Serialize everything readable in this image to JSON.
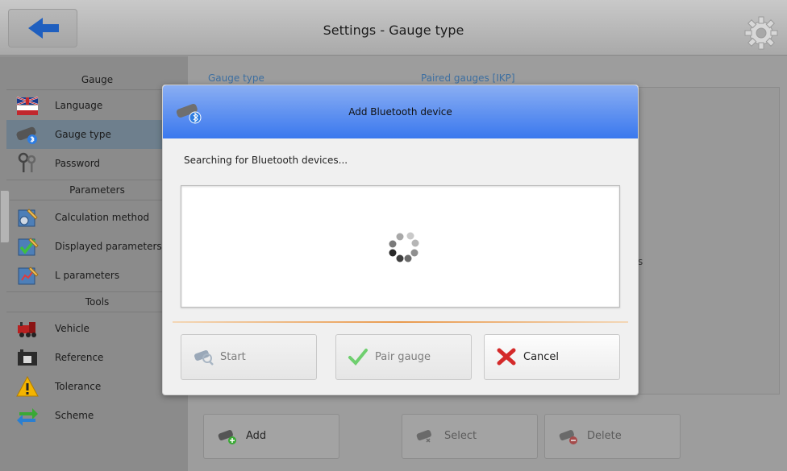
{
  "header": {
    "title": "Settings - Gauge type"
  },
  "sidebar": {
    "sections": [
      "Gauge",
      "Parameters",
      "Tools"
    ],
    "items": [
      {
        "label": "Language",
        "icon": "uk-flag-icon"
      },
      {
        "label": "Gauge type",
        "icon": "bluetooth-gauge-icon"
      },
      {
        "label": "Password",
        "icon": "keys-icon"
      },
      {
        "label": "Calculation method",
        "icon": "calculation-icon"
      },
      {
        "label": "Displayed parameters",
        "icon": "checklist-icon"
      },
      {
        "label": "L parameters",
        "icon": "edit-chart-icon"
      },
      {
        "label": "Vehicle",
        "icon": "locomotive-icon"
      },
      {
        "label": "Reference",
        "icon": "reference-block-icon"
      },
      {
        "label": "Tolerance",
        "icon": "warning-icon"
      },
      {
        "label": "Scheme",
        "icon": "swap-arrows-icon"
      }
    ],
    "active_item": "Gauge type"
  },
  "content": {
    "col_gauge_type": "Gauge type",
    "col_paired": "Paired gauges [IKP]",
    "partial_text": "s",
    "buttons": {
      "add": "Add",
      "select": "Select",
      "delete": "Delete"
    }
  },
  "dialog": {
    "title": "Add Bluetooth device",
    "status": "Searching for Bluetooth devices...",
    "buttons": {
      "start": "Start",
      "pair": "Pair gauge",
      "cancel": "Cancel"
    }
  },
  "colors": {
    "dialog_header": "#3a78ee",
    "accent_divider": "#e99a4e",
    "back_arrow": "#1f5fbf",
    "active_item": "#6e7f8d"
  }
}
